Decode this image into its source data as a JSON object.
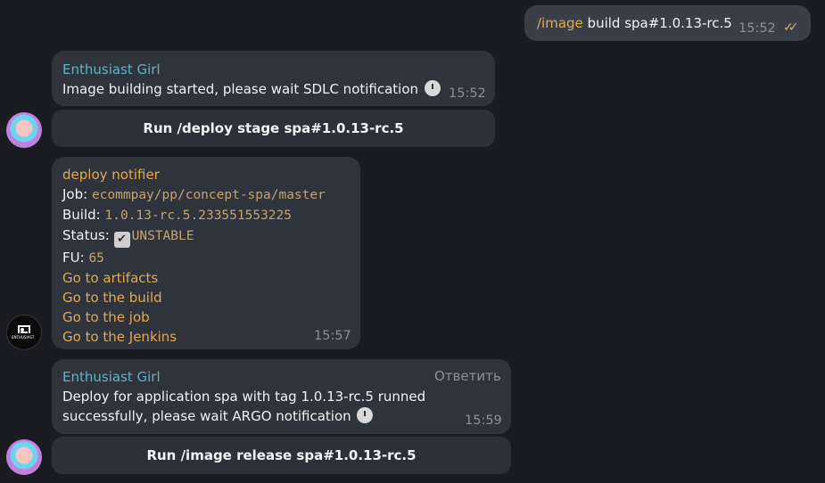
{
  "msg1": {
    "command": "/image",
    "rest": " build spa#1.0.13-rc.5",
    "time": "15:52",
    "ticks": "✓✓"
  },
  "msg2": {
    "sender": "Enthusiast Girl",
    "text": "Image building started, please wait SDLC notification",
    "time": "15:52",
    "button": "Run /deploy stage spa#1.0.13-rc.5"
  },
  "msg3": {
    "sender": "deploy notifier",
    "job_label": "Job: ",
    "job_value": "ecommpay/pp/concept-spa/master",
    "build_label": "Build: ",
    "build_value": "1.0.13-rc.5.233551553225",
    "status_label": "Status: ",
    "status_value": "UNSTABLE",
    "fu_label": "FU: ",
    "fu_value": "65",
    "links": [
      "Go to artifacts",
      "Go to the build",
      "Go to the job",
      "Go to the Jenkins"
    ],
    "time": "15:57",
    "avatar_text": "ENTHUSIAST"
  },
  "msg4": {
    "sender": "Enthusiast Girl",
    "reply": "Ответить",
    "line1": "Deploy for application spa with tag 1.0.13-rc.5 runned",
    "line2": "successfully, please wait ARGO notification",
    "time": "15:59",
    "button": "Run /image release spa#1.0.13-rc.5"
  },
  "colors": {
    "background": "#1b1c21",
    "bubble": "#2f333b",
    "sender_blue": "#5fb3c6",
    "accent_orange": "#e3a952"
  },
  "icons": {
    "stopwatch": "stopwatch-icon",
    "check": "check-box-icon",
    "read": "double-check-icon"
  }
}
